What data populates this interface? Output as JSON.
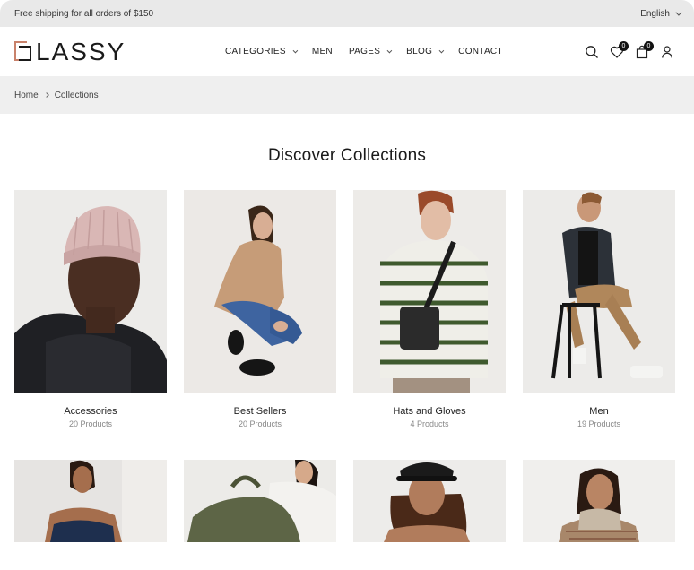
{
  "promo": {
    "text": "Free shipping for all orders of $150",
    "language": "English"
  },
  "header": {
    "logo_text": "LASSY",
    "nav": [
      {
        "label": "CATEGORIES",
        "has_dropdown": true
      },
      {
        "label": "MEN",
        "has_dropdown": false
      },
      {
        "label": "PAGES",
        "has_dropdown": true
      },
      {
        "label": "BLOG",
        "has_dropdown": true
      },
      {
        "label": "CONTACT",
        "has_dropdown": false
      }
    ],
    "icons": {
      "search": "search-icon",
      "wishlist": "heart-icon",
      "cart": "bag-icon",
      "account": "user-icon"
    },
    "wishlist_count": "0",
    "cart_count": "0"
  },
  "breadcrumb": {
    "home": "Home",
    "current": "Collections"
  },
  "page_title": "Discover Collections",
  "collections": [
    {
      "name": "Accessories",
      "count": "20 Products"
    },
    {
      "name": "Best Sellers",
      "count": "20 Products"
    },
    {
      "name": "Hats and Gloves",
      "count": "4 Products"
    },
    {
      "name": "Men",
      "count": "19 Products"
    }
  ],
  "colors": {
    "promo_bg": "#e9e9e9",
    "breadcrumb_bg": "#efefef",
    "logo_accent": "#c9826b",
    "text": "#222222"
  }
}
